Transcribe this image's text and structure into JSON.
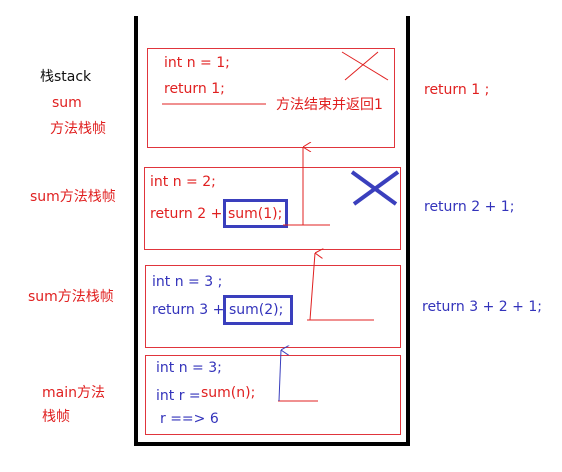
{
  "left_labels": {
    "stack_line1": "栈stack",
    "stack_line2": "sum",
    "stack_line3": "方法栈帧",
    "frame2": "sum方法栈帧",
    "frame3": "sum方法栈帧",
    "main_line1": "main方法",
    "main_line2": "栈帧"
  },
  "frames": {
    "f1": {
      "line1": "int n = 1;",
      "line2": "return 1;",
      "note": "方法结束并返回1"
    },
    "f2": {
      "line1": "int n = 2;",
      "line2_prefix": "return 2 + ",
      "call": "sum(1);"
    },
    "f3": {
      "line1": "int n = 3 ;",
      "line2_prefix": "return 3 + ",
      "call": "sum(2);"
    },
    "main": {
      "line1": "int n = 3;",
      "line2_prefix": "int r = ",
      "call": "sum(n);",
      "line3": "r ==> 6"
    }
  },
  "right_labels": {
    "r1": "return 1 ;",
    "r2": "return 2 + 1;",
    "r3": "return 3 + 2 + 1;"
  },
  "colors": {
    "red": "#e02020",
    "blue": "#3a3fbd",
    "black": "#000000"
  }
}
